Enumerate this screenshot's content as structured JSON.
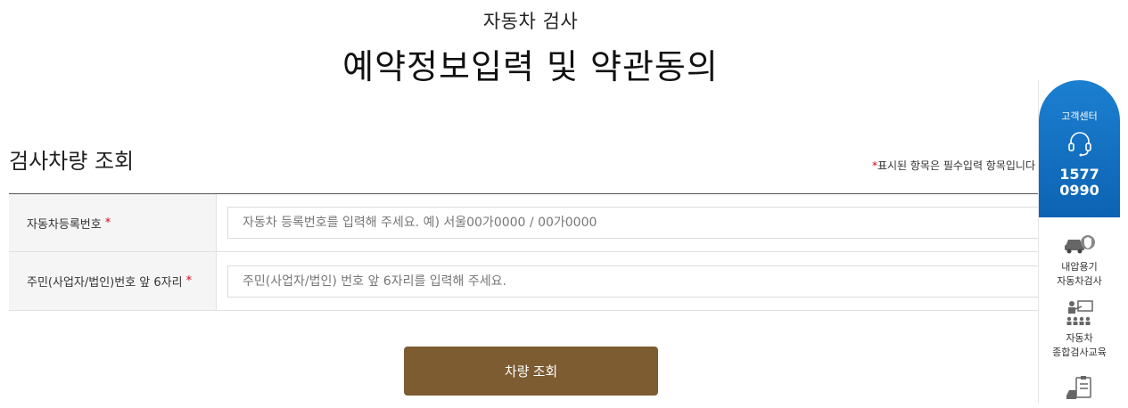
{
  "header": {
    "subtitle": "자동차 검사",
    "title": "예약정보입력 및 약관동의"
  },
  "section": {
    "title": "검사차량 조회",
    "required_note_star": "*",
    "required_note": "표시된 항목은 필수입력 항목입니다"
  },
  "form": {
    "rows": [
      {
        "label": "자동차등록번호",
        "required_mark": "*",
        "placeholder": "자동차 등록번호를 입력해 주세요. 예) 서울00가0000 / 00가0000"
      },
      {
        "label": "주민(사업자/법인)번호 앞 6자리",
        "required_mark": "*",
        "placeholder": "주민(사업자/법인) 번호 앞 6자리를 입력해 주세요."
      }
    ],
    "submit_label": "차량 조회"
  },
  "side_panel": {
    "customer_center": {
      "label": "고객센터",
      "phone_line1": "1577",
      "phone_line2": "0990",
      "icon": "headset-icon"
    },
    "items": [
      {
        "label_line1": "내압용기",
        "label_line2": "자동차검사",
        "icon": "car-tank-icon"
      },
      {
        "label_line1": "자동차",
        "label_line2": "종합검사교육",
        "icon": "lecture-icon"
      },
      {
        "label_line1": "",
        "label_line2": "",
        "icon": "checklist-car-icon"
      }
    ]
  },
  "colors": {
    "primary_button": "#7d5c32",
    "customer_center": "#1573c6",
    "required": "#d0021b"
  }
}
